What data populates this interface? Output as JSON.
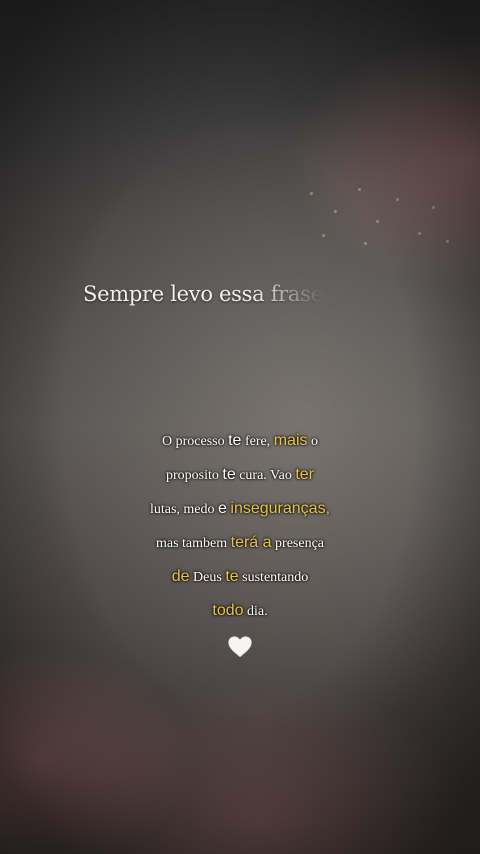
{
  "caption": "Sempre levo essa frase",
  "quote": {
    "line1": {
      "a": "O processo",
      "b": "te",
      "c": "fere,",
      "d": "mais",
      "e": "o"
    },
    "line2": {
      "a": "proposito",
      "b": "te",
      "c": "cura. Vao",
      "d": "ter"
    },
    "line3": {
      "a": "lutas, medo",
      "b": "e",
      "c": "inseguranças,"
    },
    "line4": {
      "a": "mas tambem",
      "b": "terá a",
      "c": "presença"
    },
    "line5": {
      "a": "de",
      "b": "Deus",
      "c": "te",
      "d": "sustentando"
    },
    "line6": {
      "a": "todo",
      "b": "dia."
    }
  },
  "heart_icon": "white-heart",
  "colors": {
    "highlight": "#e8c54a",
    "text": "#ffffff"
  }
}
